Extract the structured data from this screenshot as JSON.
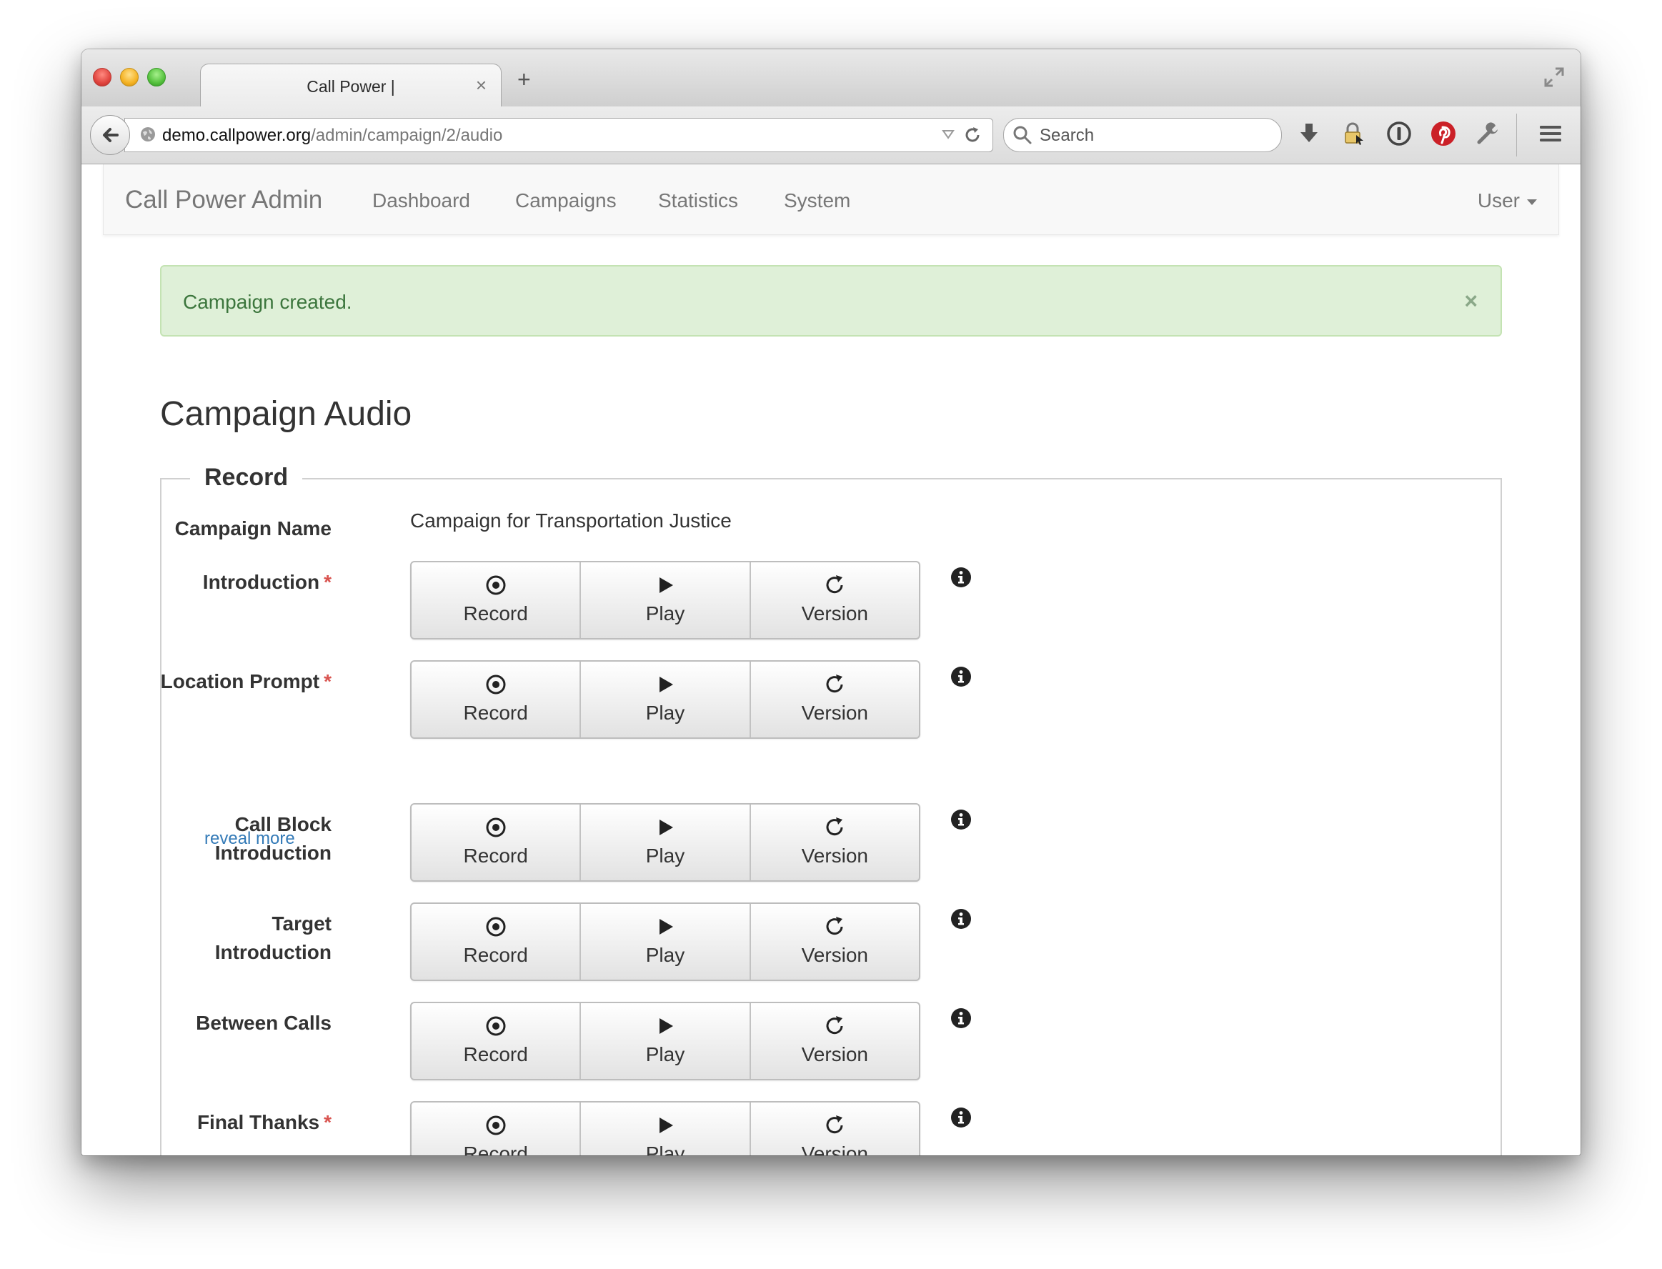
{
  "browser": {
    "tab_title": "Call Power |",
    "url_host": "demo.callpower.org",
    "url_prefix": "",
    "url_path": "/admin/campaign/2/audio",
    "search_placeholder": "Search"
  },
  "app_nav": {
    "brand": "Call Power Admin",
    "links": [
      "Dashboard",
      "Campaigns",
      "Statistics",
      "System"
    ],
    "user_menu": "User"
  },
  "alert": {
    "message": "Campaign created.",
    "close": "×"
  },
  "page": {
    "title": "Campaign Audio",
    "legend": "Record",
    "campaign_name_label": "Campaign Name",
    "campaign_name_value": "Campaign for Transportation Justice",
    "reveal_more": "reveal more",
    "required_marker": "*"
  },
  "button_labels": {
    "record": "Record",
    "play": "Play",
    "version": "Version"
  },
  "audio_fields": [
    {
      "label_lines": [
        "Introduction"
      ],
      "required": true
    },
    {
      "label_lines": [
        "Location Prompt"
      ],
      "required": true
    },
    {
      "label_lines": [
        "Call Block",
        "Introduction"
      ],
      "required": false
    },
    {
      "label_lines": [
        "Target",
        "Introduction"
      ],
      "required": false
    },
    {
      "label_lines": [
        "Between Calls"
      ],
      "required": false
    },
    {
      "label_lines": [
        "Final Thanks"
      ],
      "required": true
    }
  ],
  "colors": {
    "alert_bg": "#dff0d8",
    "alert_text": "#3c763d",
    "link": "#337ab7",
    "required": "#d9534f"
  }
}
